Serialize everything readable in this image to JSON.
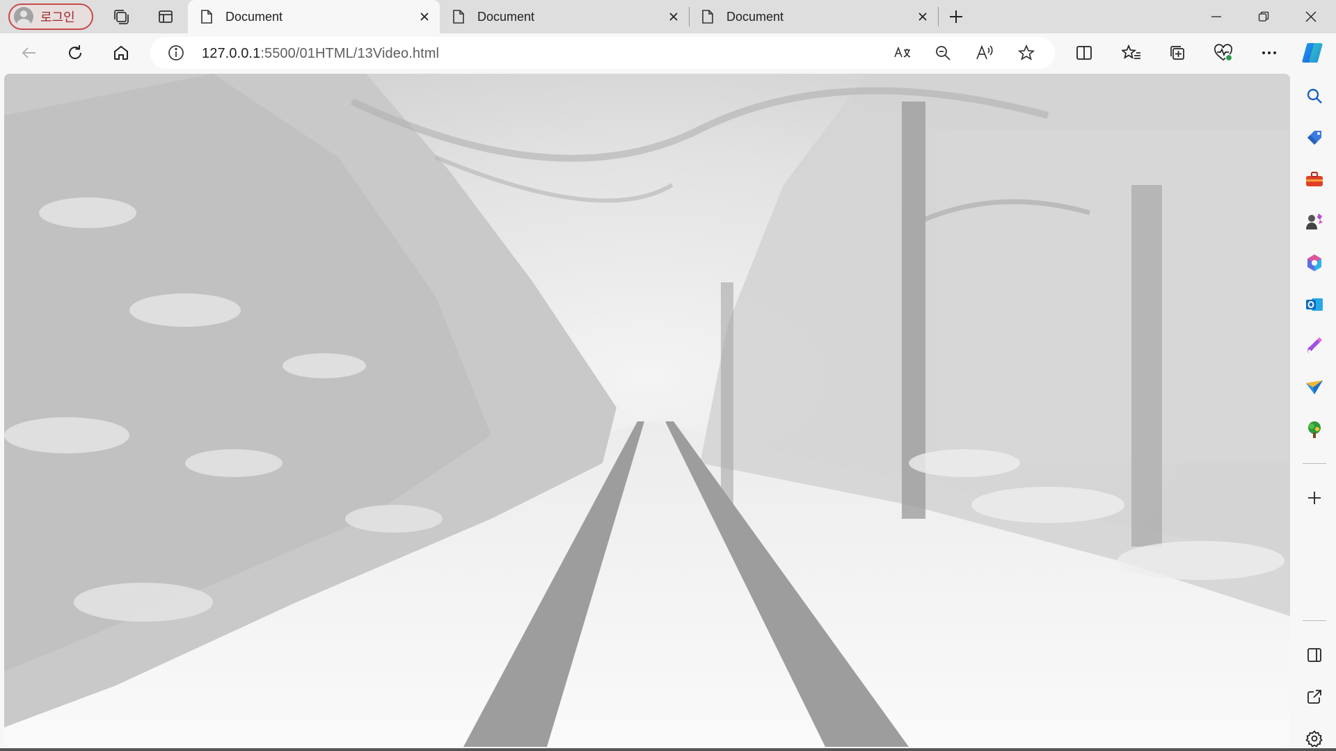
{
  "browser": {
    "profile_label": "로그인",
    "tabs": [
      {
        "title": "Document",
        "active": true
      },
      {
        "title": "Document",
        "active": false
      },
      {
        "title": "Document",
        "active": false
      }
    ],
    "url_host": "127.0.0.1",
    "url_path": ":5500/01HTML/13Video.html"
  },
  "icons": {
    "tabstrip": [
      "profile-avatar-icon",
      "workspaces-icon",
      "vertical-tabs-icon",
      "document-icon",
      "close-icon",
      "new-tab-plus-icon"
    ],
    "window_controls": [
      "minimize-icon",
      "restore-icon",
      "close-icon"
    ],
    "toolbar": [
      "back-arrow-icon",
      "refresh-icon",
      "home-icon",
      "info-icon",
      "translate-icon",
      "zoom-out-icon",
      "read-aloud-icon",
      "favorite-star-icon",
      "split-screen-icon",
      "favorites-icon",
      "collections-icon",
      "browser-essentials-icon",
      "more-icon",
      "copilot-icon"
    ],
    "sidebar": [
      "search-icon",
      "shopping-tag-icon",
      "tools-briefcase-icon",
      "games-icon",
      "microsoft365-icon",
      "outlook-icon",
      "designer-icon",
      "drop-icon",
      "tree-icon",
      "add-icon",
      "sidebar-panel-icon",
      "open-external-icon",
      "settings-gear-icon"
    ]
  },
  "colors": {
    "profile_border": "#c44a4a",
    "tabstrip_bg": "#dedede",
    "toolbar_bg": "#f7f7f7"
  },
  "content": {
    "description_visible": ""
  }
}
